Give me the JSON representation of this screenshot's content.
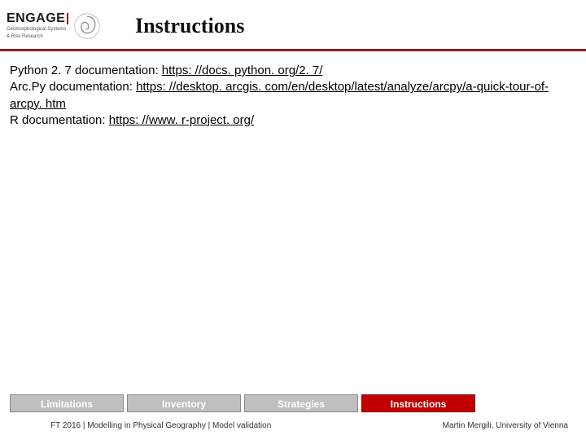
{
  "header": {
    "logo_text": "ENGAGE",
    "logo_sub1": "Geomorphological Systems",
    "logo_sub2": "& Risk Research",
    "title": "Instructions"
  },
  "content": {
    "line1_label": "Python 2. 7 documentation: ",
    "line1_link": "https: //docs. python. org/2. 7/",
    "line2_label": "Arc.Py documentation: ",
    "line2_link": "https: //desktop. arcgis. com/en/desktop/latest/analyze/arcpy/a-quick-tour-of-arcpy. htm",
    "line3_label": "R documentation: ",
    "line3_link": "https: //www. r-project. org/"
  },
  "tabs": {
    "t0": "Limitations",
    "t1": "Inventory",
    "t2": "Strategies",
    "t3": "Instructions"
  },
  "footer": {
    "left": "FT 2016  |  Modelling in Physical Geography  |  Model validation",
    "right": "Martin Mergili, University of Vienna"
  }
}
